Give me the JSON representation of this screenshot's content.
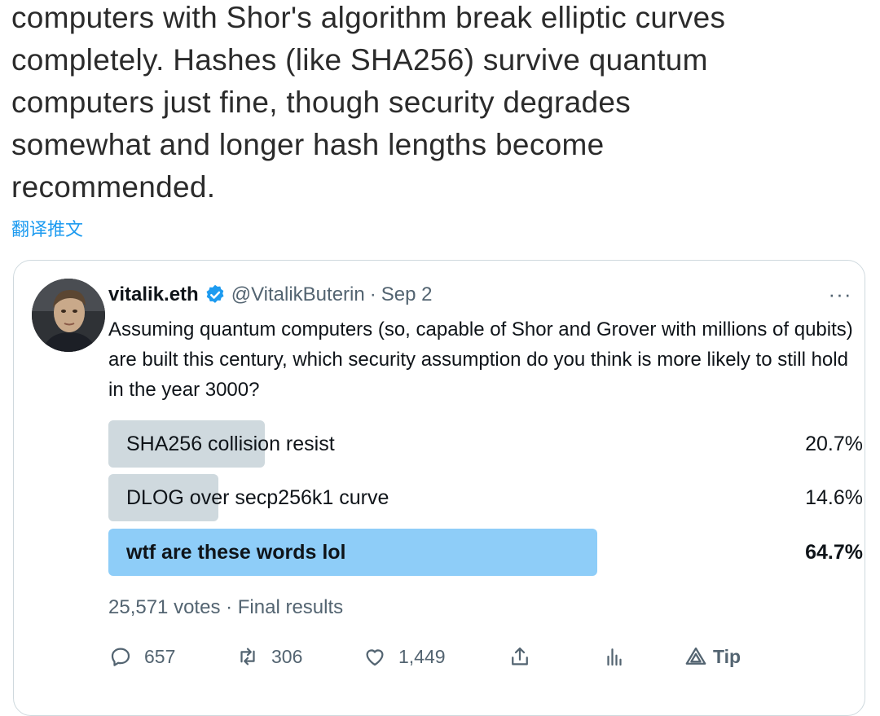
{
  "tweet": {
    "text": "computers with Shor's algorithm break elliptic curves\ncompletely. Hashes (like SHA256) survive quantum\ncomputers just fine, though security degrades\nsomewhat and longer hash lengths become\nrecommended.",
    "translate_label": "翻译推文"
  },
  "quote": {
    "author_name": "vitalik.eth",
    "author_handle": "@VitalikButerin",
    "separator": "·",
    "date": "Sep 2",
    "more_label": "···",
    "text": "Assuming quantum computers (so, capable of Shor and Grover with millions of qubits) are built this century, which security assumption do you think is more likely to still hold in the year 3000?",
    "poll": {
      "options": [
        {
          "label": "SHA256 collision resist",
          "percent_label": "20.7%",
          "percent": 20.7,
          "winner": false
        },
        {
          "label": "DLOG over secp256k1 curve",
          "percent_label": "14.6%",
          "percent": 14.6,
          "winner": false
        },
        {
          "label": "wtf are these words lol",
          "percent_label": "64.7%",
          "percent": 64.7,
          "winner": true
        }
      ],
      "summary": "25,571 votes · Final results"
    },
    "actions": {
      "reply_count": "657",
      "retweet_count": "306",
      "like_count": "1,449",
      "tip_label": "Tip"
    }
  },
  "colors": {
    "accent": "#1d9bf0",
    "poll_winner": "#8ecdf8",
    "poll_other": "#cfd9de",
    "secondary_text": "#536471"
  },
  "icons": [
    "verified-badge-icon",
    "more-icon",
    "reply-icon",
    "retweet-icon",
    "like-icon",
    "share-icon",
    "analytics-icon",
    "tip-icon"
  ]
}
